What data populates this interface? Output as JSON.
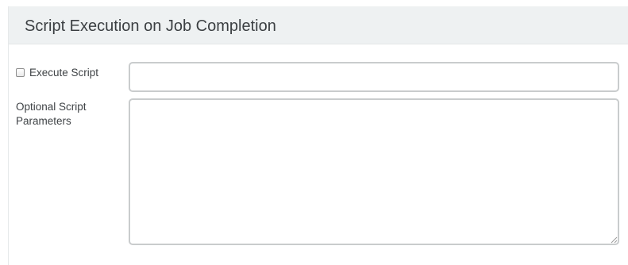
{
  "panel": {
    "title": "Script Execution on Job Completion"
  },
  "execute_script": {
    "label": "Execute Script",
    "checked": false,
    "value": "",
    "placeholder": ""
  },
  "optional_params": {
    "label": "Optional Script Parameters",
    "value": "",
    "placeholder": ""
  }
}
